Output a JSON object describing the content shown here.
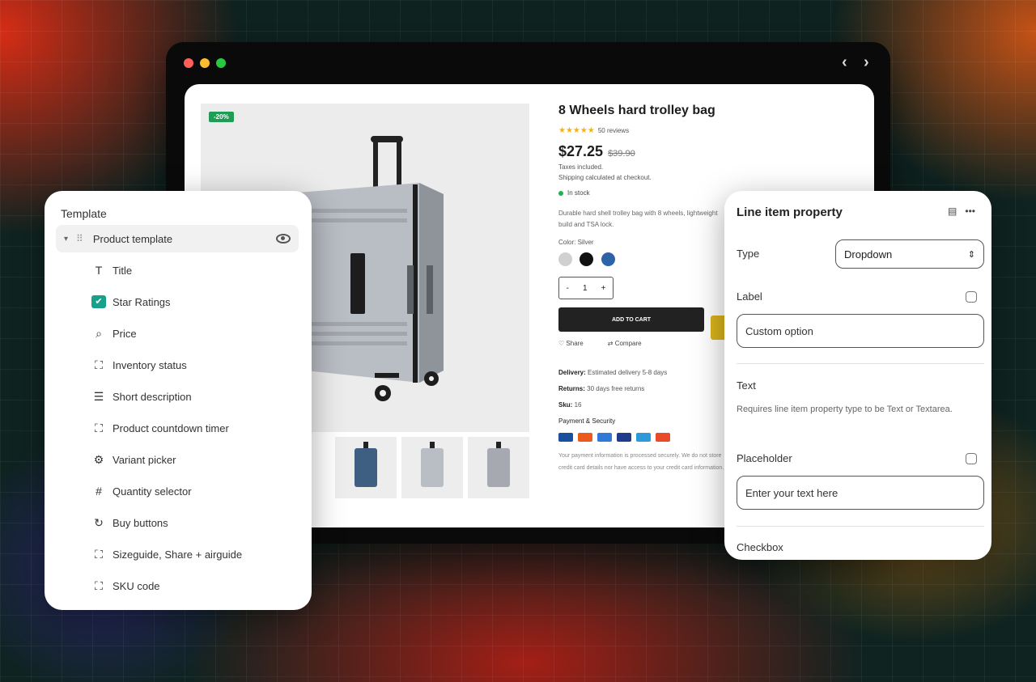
{
  "device": {
    "traffic_colors": [
      "#ff5f57",
      "#febc2e",
      "#28c840"
    ],
    "back_icon": "chevron-left",
    "forward_icon": "chevron-right"
  },
  "product": {
    "badge": "-20%",
    "title": "8 Wheels hard trolley bag",
    "rating_stars": "★★★★★",
    "review_count": "50 reviews",
    "price": "$27.25",
    "old_price": "$39.90",
    "tax_note": "Taxes included.",
    "shipping_note": "Shipping calculated at checkout.",
    "stock": "In stock",
    "description": "Durable hard shell trolley bag with 8 wheels, lightweight build and TSA lock.",
    "color_label": "Color: Silver",
    "colors": [
      "#d0d0d0",
      "#111111",
      "#2f63a8"
    ],
    "qty_minus": "-",
    "qty_value": "1",
    "qty_plus": "+",
    "add_to_cart": "ADD TO CART",
    "link_share": "Share",
    "link_compare": "Compare",
    "delivery_label": "Delivery:",
    "delivery_value": "Estimated delivery 5-8 days",
    "returns_label": "Returns:",
    "returns_value": "30 days free returns",
    "sku_label": "Sku:",
    "sku_value": "16",
    "payment_label": "Payment & Security",
    "card_colors": [
      "#1a4fa0",
      "#eb5a1a",
      "#2f7ad8",
      "#1f3b8c",
      "#2a9ad8",
      "#e84a2a"
    ],
    "footer_text": "Your payment information is processed securely. We do not store credit card details nor have access to your credit card information."
  },
  "template_panel": {
    "title": "Template",
    "root_item": "Product template",
    "items": [
      {
        "label": "Title",
        "icon": "T"
      },
      {
        "label": "Star Ratings",
        "icon": "✔"
      },
      {
        "label": "Price",
        "icon": "⌕"
      },
      {
        "label": "Inventory status",
        "icon": "⛶"
      },
      {
        "label": "Short description",
        "icon": "☰"
      },
      {
        "label": "Product countdown timer",
        "icon": "⛶"
      },
      {
        "label": "Variant picker",
        "icon": "⚙"
      },
      {
        "label": "Quantity selector",
        "icon": "#"
      },
      {
        "label": "Buy buttons",
        "icon": "↻"
      },
      {
        "label": "Sizeguide, Share + airguide",
        "icon": "⛶"
      },
      {
        "label": "SKU code",
        "icon": "⛶"
      }
    ]
  },
  "property_panel": {
    "title": "Line item property",
    "type_label": "Type",
    "type_value": "Dropdown",
    "label_label": "Label",
    "label_value": "Custom option",
    "text_heading": "Text",
    "text_help": "Requires line item property type to be Text or Textarea.",
    "placeholder_label": "Placeholder",
    "placeholder_value": "Enter your text here",
    "checkbox_heading": "Checkbox"
  }
}
